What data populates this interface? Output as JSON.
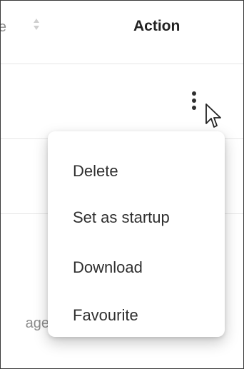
{
  "header": {
    "clipped_label": "e",
    "action_label": "Action",
    "sort_icon": "sort-icon"
  },
  "rows": [
    {
      "actions_icon": "kebab-vertical-icon"
    },
    {}
  ],
  "partial_text": "age",
  "menu": {
    "items": [
      {
        "label": "Delete"
      },
      {
        "label": "Set as startup"
      },
      {
        "label": "Download"
      },
      {
        "label": "Favourite"
      }
    ]
  },
  "cursor_icon": "mouse-pointer-icon",
  "colors": {
    "text": "#2f2f2f",
    "muted": "#8c8c8c",
    "border": "#e6e6e6",
    "menu_bg": "#ffffff"
  }
}
